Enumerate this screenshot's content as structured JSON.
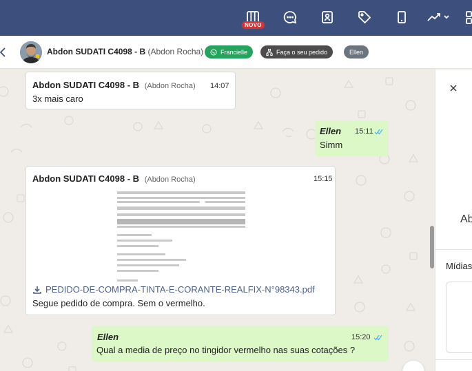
{
  "topnav": {
    "badge": "NOVO",
    "icons": [
      "kanban-icon",
      "chat-bubble-icon",
      "contacts-icon",
      "tag-icon",
      "mobile-icon",
      "trend-icon",
      "grid-icon"
    ]
  },
  "header": {
    "contact_name": "Abdon SUDATI C4098 - B",
    "contact_sub": "(Abdon Rocha)",
    "chip_whatsapp": "Francielle",
    "chip_order": "Faça o seu pedido",
    "chip_agent": "Ellen"
  },
  "messages": [
    {
      "sender": "Abdon SUDATI C4098 - B",
      "sender_sub": "(Abdon Rocha)",
      "time": "14:07",
      "text": "3x mais caro"
    },
    {
      "sender": "Ellen",
      "time": "15:11",
      "text": "Simm"
    },
    {
      "sender": "Abdon SUDATI C4098 - B",
      "sender_sub": "(Abdon Rocha)",
      "time": "15:15",
      "file": "PEDIDO-DE-COMPRA-TINTA-E-CORANTE-REALFIX-N°98343.pdf",
      "text": "Segue pedido de compra. Sem o vermelho."
    },
    {
      "sender": "Ellen",
      "time": "15:20",
      "text": "Qual a media de preço no tingidor vermelho nas suas cotações ?"
    }
  ],
  "right_panel": {
    "name_partial": "Ab",
    "section_title": "Mídias"
  },
  "colors": {
    "nav_bg": "#3d4f7c",
    "outgoing_bg": "#dcf8c6",
    "whatsapp_chip": "#22a45d",
    "read_ticks": "#4fb6ec"
  }
}
